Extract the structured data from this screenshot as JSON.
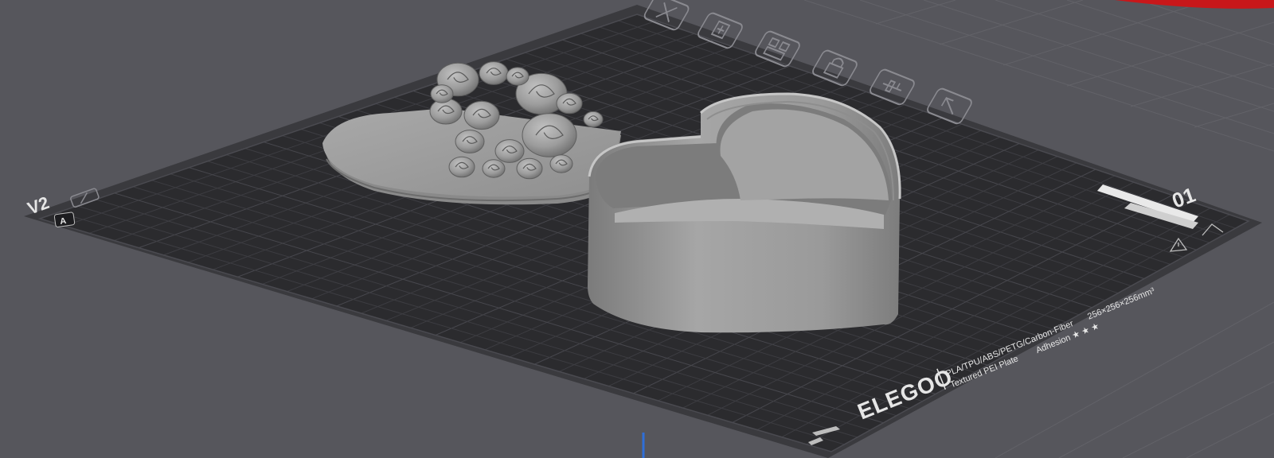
{
  "plate": {
    "version_label": "V2",
    "side_label": "A",
    "plate_number": "01",
    "brand": "ELEGOO",
    "spec_line1": "PLA/TPU/ABS/PETG/Carbon-Fiber",
    "spec_size": "256×256×256mm³",
    "spec_line2": "Textured PEI Plate",
    "spec_adhesion": "Adhesion ★ ★ ★"
  },
  "plate_toolbar": {
    "icons": [
      "close-icon",
      "add-model-icon",
      "arrange-icon",
      "lock-icon",
      "plate-settings-icon",
      "back-icon"
    ]
  },
  "models": [
    "heart-box-lid-with-roses",
    "heart-box-base"
  ],
  "colors": {
    "background": "#56565c",
    "bed_plate": "#2b2b2e",
    "grid_line": "#3c3c40",
    "model": "#9a9a9a",
    "accent": "#e8603c",
    "axis_y": "#2f6fd8",
    "toolbar_stroke": "#8a8a90"
  }
}
